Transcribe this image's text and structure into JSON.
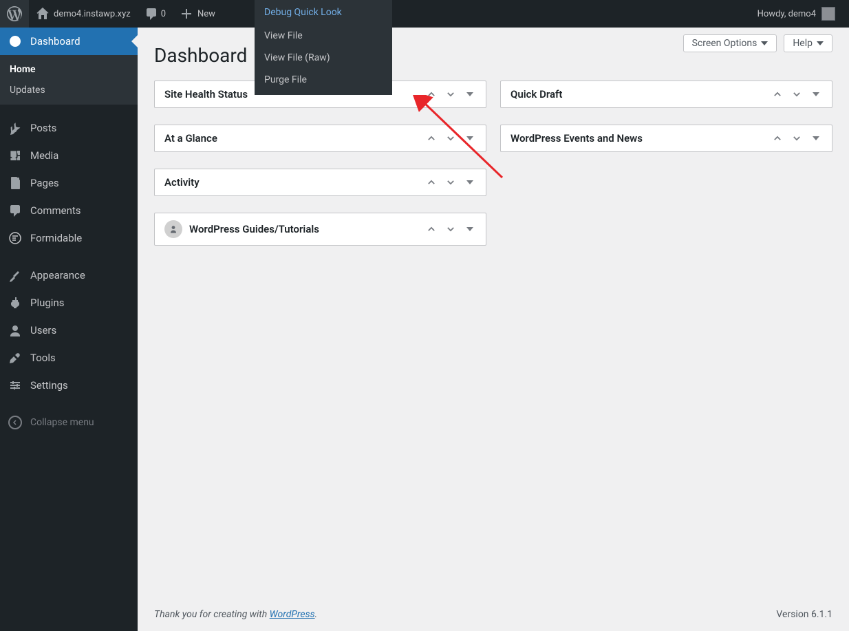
{
  "adminbar": {
    "site_name": "demo4.instawp.xyz",
    "comments_count": "0",
    "new_label": "New",
    "debug_label": "Debug Quick Look",
    "howdy": "Howdy, demo4"
  },
  "dropdown": {
    "header": "Debug Quick Look",
    "items": [
      "View File",
      "View File (Raw)",
      "Purge File"
    ]
  },
  "sidebar": {
    "items": [
      {
        "label": "Dashboard",
        "icon": "dashboard-icon",
        "current": true
      },
      {
        "label": "Posts",
        "icon": "posts-icon"
      },
      {
        "label": "Media",
        "icon": "media-icon"
      },
      {
        "label": "Pages",
        "icon": "pages-icon"
      },
      {
        "label": "Comments",
        "icon": "comments-icon"
      },
      {
        "label": "Formidable",
        "icon": "formidable-icon"
      },
      {
        "label": "Appearance",
        "icon": "appearance-icon"
      },
      {
        "label": "Plugins",
        "icon": "plugins-icon"
      },
      {
        "label": "Users",
        "icon": "users-icon"
      },
      {
        "label": "Tools",
        "icon": "tools-icon"
      },
      {
        "label": "Settings",
        "icon": "settings-icon"
      }
    ],
    "submenu": [
      "Home",
      "Updates"
    ],
    "collapse": "Collapse menu"
  },
  "page": {
    "title": "Dashboard",
    "screen_options": "Screen Options",
    "help": "Help"
  },
  "widgets": {
    "left": [
      {
        "title": "Site Health Status"
      },
      {
        "title": "At a Glance"
      },
      {
        "title": "Activity"
      },
      {
        "title": "WordPress Guides/Tutorials",
        "icon": true
      }
    ],
    "right": [
      {
        "title": "Quick Draft"
      },
      {
        "title": "WordPress Events and News"
      }
    ]
  },
  "footer": {
    "thank_prefix": "Thank you for creating with ",
    "wp_link": "WordPress",
    "thank_suffix": ".",
    "version": "Version 6.1.1"
  }
}
